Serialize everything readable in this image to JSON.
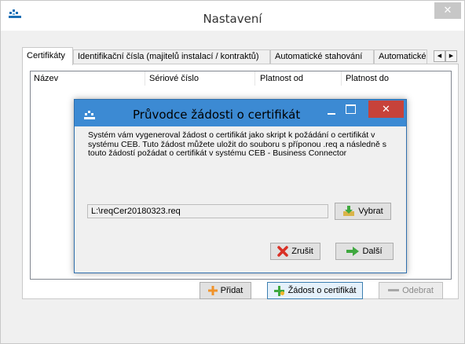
{
  "window": {
    "title": "Nastavení",
    "close_glyph": "✕"
  },
  "tabs": [
    {
      "label": "Certifikáty",
      "active": true
    },
    {
      "label": "Identifikační čísla (majitelů instalací / kontraktů)",
      "active": false
    },
    {
      "label": "Automatické stahování",
      "active": false
    },
    {
      "label": "Automatické",
      "active": false
    }
  ],
  "tab_scroll": {
    "left": "◀",
    "right": "▶"
  },
  "list": {
    "columns": [
      "Název",
      "Sériové číslo",
      "Platnost od",
      "Platnost do"
    ]
  },
  "buttons": {
    "add": "Přidat",
    "request": "Žádost o certifikát",
    "remove": "Odebrat"
  },
  "dialog": {
    "title": "Průvodce žádosti o certifikát",
    "close_glyph": "✕",
    "message": "Systém vám vygeneroval žádost o certifikát jako skript k požádání o certifikát v systému CEB. Tuto žádost můžete uložit do souboru s příponou .req a následně s touto žádostí požádat o certifikát v systému CEB - Business Connector",
    "path_value": "L:\\reqCer20180323.req",
    "browse_label": "Vybrat",
    "cancel_label": "Zrušit",
    "next_label": "Další"
  },
  "colors": {
    "dialog_titlebar": "#3c8ad3",
    "dialog_close": "#c7423a",
    "focus_border": "#3c7fb1"
  }
}
